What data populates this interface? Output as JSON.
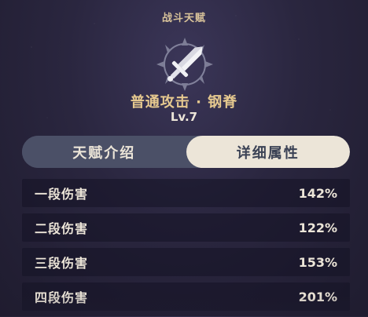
{
  "header": {
    "section_label": "战斗天赋"
  },
  "talent": {
    "icon": "sword-icon",
    "name": "普通攻击 · 钢脊",
    "level": "Lv.7"
  },
  "tabs": [
    {
      "label": "天赋介绍",
      "active": false
    },
    {
      "label": "详细属性",
      "active": true
    }
  ],
  "stats": [
    {
      "name": "一段伤害",
      "value": "142%"
    },
    {
      "name": "二段伤害",
      "value": "122%"
    },
    {
      "name": "三段伤害",
      "value": "153%"
    },
    {
      "name": "四段伤害",
      "value": "201%"
    }
  ],
  "colors": {
    "accent_gold": "#e6c98f",
    "tab_active_bg": "#ece5d8",
    "tab_inactive_bg": "#4b5067",
    "background": "#2a263f"
  }
}
